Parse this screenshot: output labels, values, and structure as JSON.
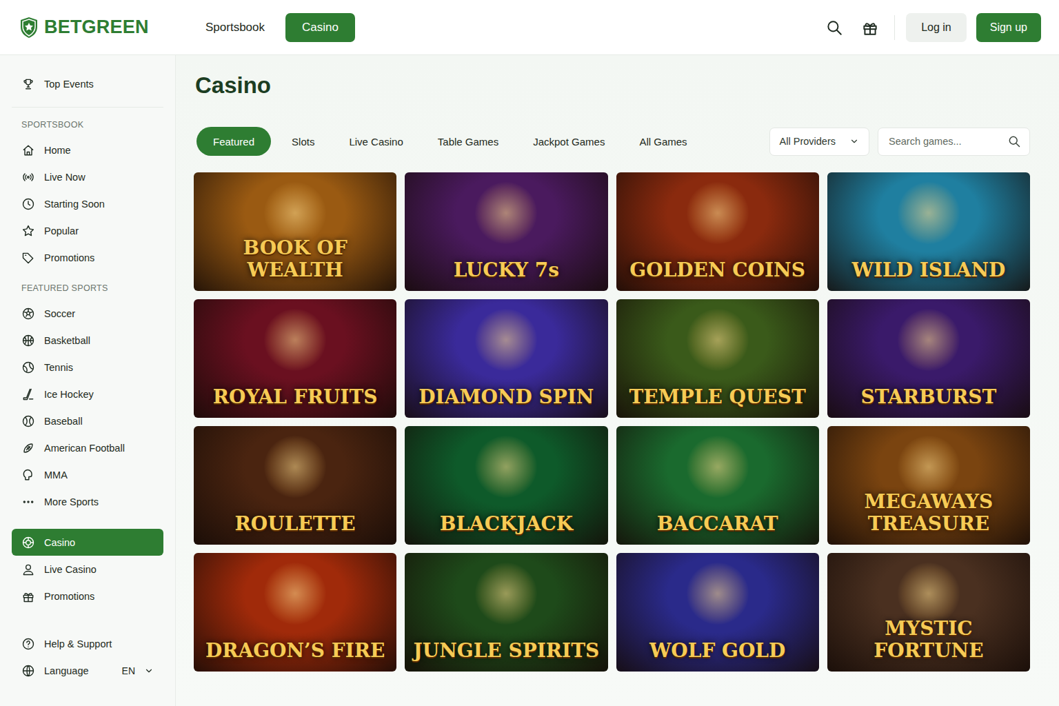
{
  "brand": {
    "name": "BETGREEN"
  },
  "top_nav": [
    {
      "label": "Sportsbook",
      "selected": false
    },
    {
      "label": "Casino",
      "selected": true
    }
  ],
  "header_actions": {
    "login": "Log in",
    "signup": "Sign up"
  },
  "sidebar": {
    "top": [
      {
        "label": "Top Events",
        "selected": false
      }
    ],
    "sections": [
      {
        "title": "SPORTSBOOK",
        "items": [
          {
            "label": "Home",
            "selected": false
          },
          {
            "label": "Live Now",
            "selected": false
          },
          {
            "label": "Starting Soon",
            "selected": false
          },
          {
            "label": "Popular",
            "selected": false
          },
          {
            "label": "Promotions",
            "selected": false
          }
        ]
      },
      {
        "title": "FEATURED SPORTS",
        "items": [
          {
            "label": "Soccer",
            "selected": false
          },
          {
            "label": "Basketball",
            "selected": false
          },
          {
            "label": "Tennis",
            "selected": false
          },
          {
            "label": "Ice Hockey",
            "selected": false
          },
          {
            "label": "Baseball",
            "selected": false
          },
          {
            "label": "American Football",
            "selected": false
          },
          {
            "label": "MMA",
            "selected": false
          },
          {
            "label": "More Sports",
            "selected": false
          }
        ]
      }
    ],
    "casino": [
      {
        "label": "Casino",
        "selected": true
      },
      {
        "label": "Live Casino",
        "selected": false
      },
      {
        "label": "Promotions",
        "selected": false
      }
    ],
    "footer": {
      "help": "Help & Support",
      "language": "Language",
      "language_value": "EN"
    }
  },
  "page": {
    "title": "Casino"
  },
  "tabs": [
    {
      "label": "Featured",
      "selected": true
    },
    {
      "label": "Slots",
      "selected": false
    },
    {
      "label": "Live Casino",
      "selected": false
    },
    {
      "label": "Table Games",
      "selected": false
    },
    {
      "label": "Jackpot Games",
      "selected": false
    },
    {
      "label": "All Games",
      "selected": false
    }
  ],
  "filters": {
    "provider": "All Providers",
    "search_placeholder": "Search games..."
  },
  "games": [
    {
      "title": "BOOK OF WEALTH",
      "color": "#9a5a12"
    },
    {
      "title": "LUCKY 7s",
      "color": "#4a1a5e"
    },
    {
      "title": "GOLDEN COINS",
      "color": "#8a2a0e"
    },
    {
      "title": "WILD ISLAND",
      "color": "#1f7fa0"
    },
    {
      "title": "ROYAL FRUITS",
      "color": "#6a1020"
    },
    {
      "title": "DIAMOND SPIN",
      "color": "#3a2a9a"
    },
    {
      "title": "TEMPLE QUEST",
      "color": "#3a5a1a"
    },
    {
      "title": "STARBURST",
      "color": "#3a1a6a"
    },
    {
      "title": "ROULETTE",
      "color": "#4a2410"
    },
    {
      "title": "BLACKJACK",
      "color": "#0e5a2a"
    },
    {
      "title": "BACCARAT",
      "color": "#1a6a2e"
    },
    {
      "title": "MEGAWAYS TREASURE",
      "color": "#7a4410"
    },
    {
      "title": "DRAGON’S FIRE",
      "color": "#a02a0a"
    },
    {
      "title": "JUNGLE SPIRITS",
      "color": "#1e4a1a"
    },
    {
      "title": "WOLF GOLD",
      "color": "#2a2a8a"
    },
    {
      "title": "MYSTIC FORTUNE",
      "color": "#4a3020"
    }
  ]
}
